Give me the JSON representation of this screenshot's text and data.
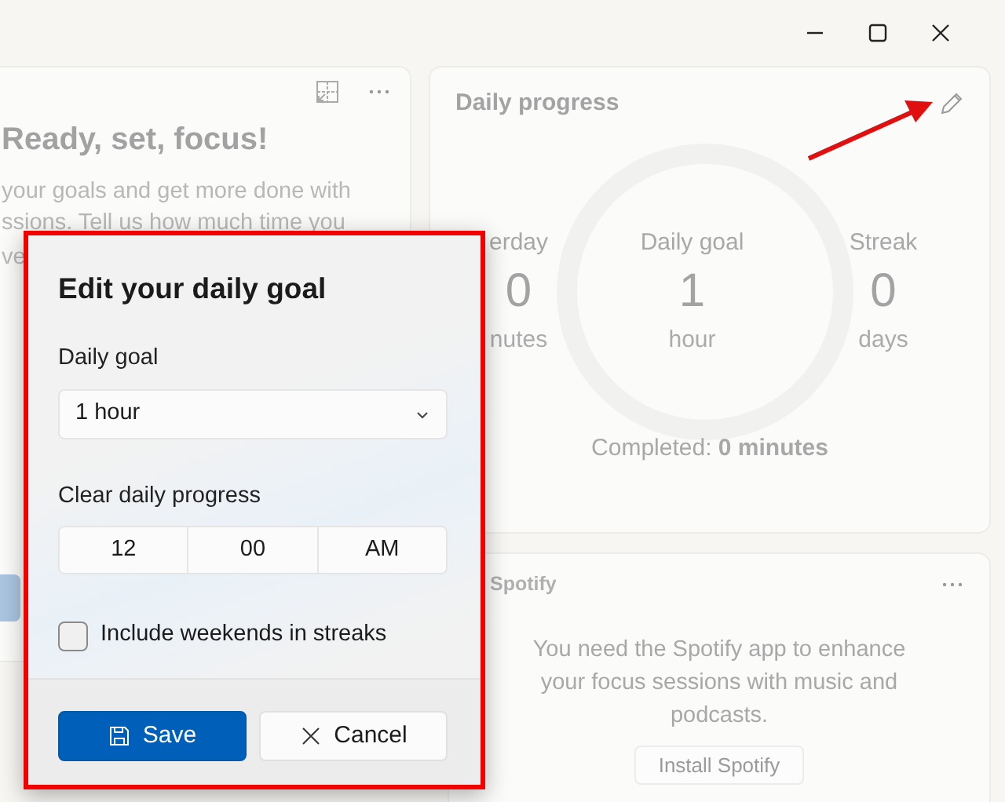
{
  "focus_card": {
    "title": "Ready, set, focus!",
    "text_lines": [
      "your goals and get more done with",
      "ssions. Tell us how much time you",
      "ve"
    ]
  },
  "progress_card": {
    "title": "Daily progress",
    "stats": [
      {
        "label": "erday",
        "value": "0",
        "unit": "nutes"
      },
      {
        "label": "Daily goal",
        "value": "1",
        "unit": "hour"
      },
      {
        "label": "Streak",
        "value": "0",
        "unit": "days"
      }
    ],
    "completed": "Completed: **0 minutes**"
  },
  "spotify_card": {
    "title": "Spotify",
    "message": "You need the Spotify app to enhance your focus sessions with music and podcasts.",
    "button": "Install Spotify"
  },
  "dialog": {
    "title": "Edit your daily goal",
    "goal_label": "Daily goal",
    "goal_value": "1 hour",
    "clear_label": "Clear daily progress",
    "time": [
      "12",
      "00",
      "AM"
    ],
    "weekends": {
      "label": "Include weekends in streaks",
      "checked": false
    },
    "buttons": [
      {
        "kind": "primary",
        "label": "Save"
      },
      {
        "kind": "secondary",
        "label": "Cancel"
      }
    ]
  }
}
